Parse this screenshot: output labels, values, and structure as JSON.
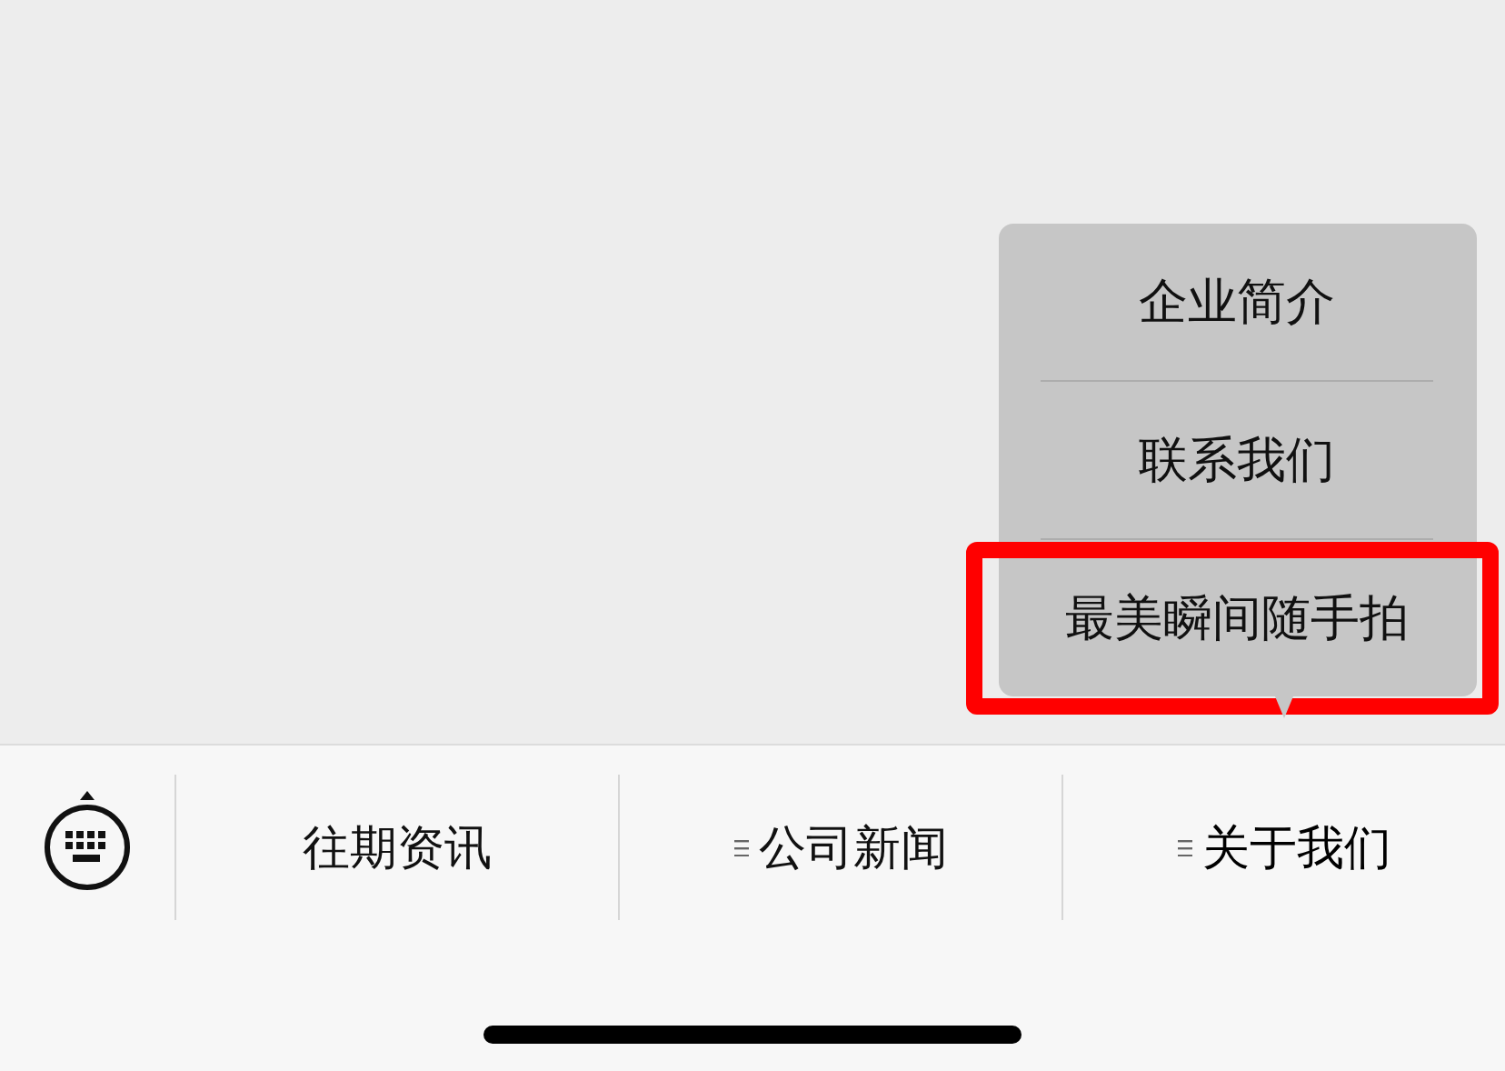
{
  "menu_bar": {
    "items": [
      {
        "label": "往期资讯",
        "has_submenu": false,
        "expanded": false
      },
      {
        "label": "公司新闻",
        "has_submenu": true,
        "expanded": false
      },
      {
        "label": "关于我们",
        "has_submenu": true,
        "expanded": true,
        "submenu": [
          {
            "label": "企业简介",
            "highlighted": false
          },
          {
            "label": "联系我们",
            "highlighted": false
          },
          {
            "label": "最美瞬间随手拍",
            "highlighted": true
          }
        ]
      }
    ]
  }
}
